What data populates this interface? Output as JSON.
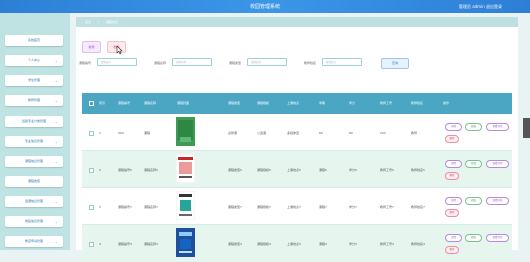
{
  "header": {
    "title": "校园管理系统",
    "user_text": "管理员 admin 退出登录"
  },
  "sidebar": {
    "items": [
      {
        "label": "系统首页"
      },
      {
        "label": "个人中心"
      },
      {
        "label": "学生管理"
      },
      {
        "label": "教师管理"
      },
      {
        "label": "班级专业分类管理"
      },
      {
        "label": "专业信息管理"
      },
      {
        "label": "课程信息管理"
      },
      {
        "label": "课程类型"
      },
      {
        "label": "选课信息管理"
      },
      {
        "label": "成绩信息管理"
      },
      {
        "label": "教室申请管理"
      }
    ]
  },
  "breadcrumb": {
    "home": "首页",
    "sep": "/",
    "current": "课程信息"
  },
  "toolbar": {
    "add_label": "新增",
    "delete_label": "删除"
  },
  "filters": [
    {
      "label": "课程编号",
      "placeholder": "课程编号"
    },
    {
      "label": "课程名称",
      "placeholder": "课程名称"
    },
    {
      "label": "课程类型",
      "placeholder": "课程类型"
    },
    {
      "label": "教师姓名",
      "placeholder": "教师姓名"
    }
  ],
  "search_label": "查询",
  "table": {
    "headers": [
      "索引",
      "课程编号",
      "课程名称",
      "课程封面",
      "课程类型",
      "课程规模",
      "上课地点",
      "学期",
      "学分",
      "教师工号",
      "教师姓名",
      "操作"
    ],
    "rows": [
      {
        "index": "1",
        "code": "003",
        "name": "课程",
        "type": "必修课",
        "scale": "公选课",
        "place": "多媒体室",
        "term": "60",
        "credit": "60",
        "teacher_id": "222",
        "teacher_name": "教师"
      },
      {
        "index": "2",
        "code": "课程编号5",
        "name": "课程名称5",
        "type": "课程类型5",
        "scale": "课程规模5",
        "place": "上课地点5",
        "term": "课程5",
        "credit": "学分5",
        "teacher_id": "教师工号5",
        "teacher_name": "教师姓名5"
      },
      {
        "index": "3",
        "code": "课程编号7",
        "name": "课程名称7",
        "type": "课程类型7",
        "scale": "课程规模7",
        "place": "上课地点7",
        "term": "课程7",
        "credit": "学分7",
        "teacher_id": "教师工号7",
        "teacher_name": "教师姓名7"
      },
      {
        "index": "4",
        "code": "课程编号3",
        "name": "课程名称3",
        "type": "课程类型3",
        "scale": "课程规模3",
        "place": "上课地点3",
        "term": "课程3",
        "credit": "学分3",
        "teacher_id": "教师工号3",
        "teacher_name": "教师姓名3"
      }
    ],
    "actions": {
      "detail": "详情",
      "edit": "修改",
      "comment": "查看评论",
      "delete": "删除"
    }
  },
  "colors": {
    "header": "#3b8fe0",
    "sidebar": "#bfe3e3",
    "table_head": "#4ba6c4",
    "row_alt": "#e6f6ef"
  }
}
